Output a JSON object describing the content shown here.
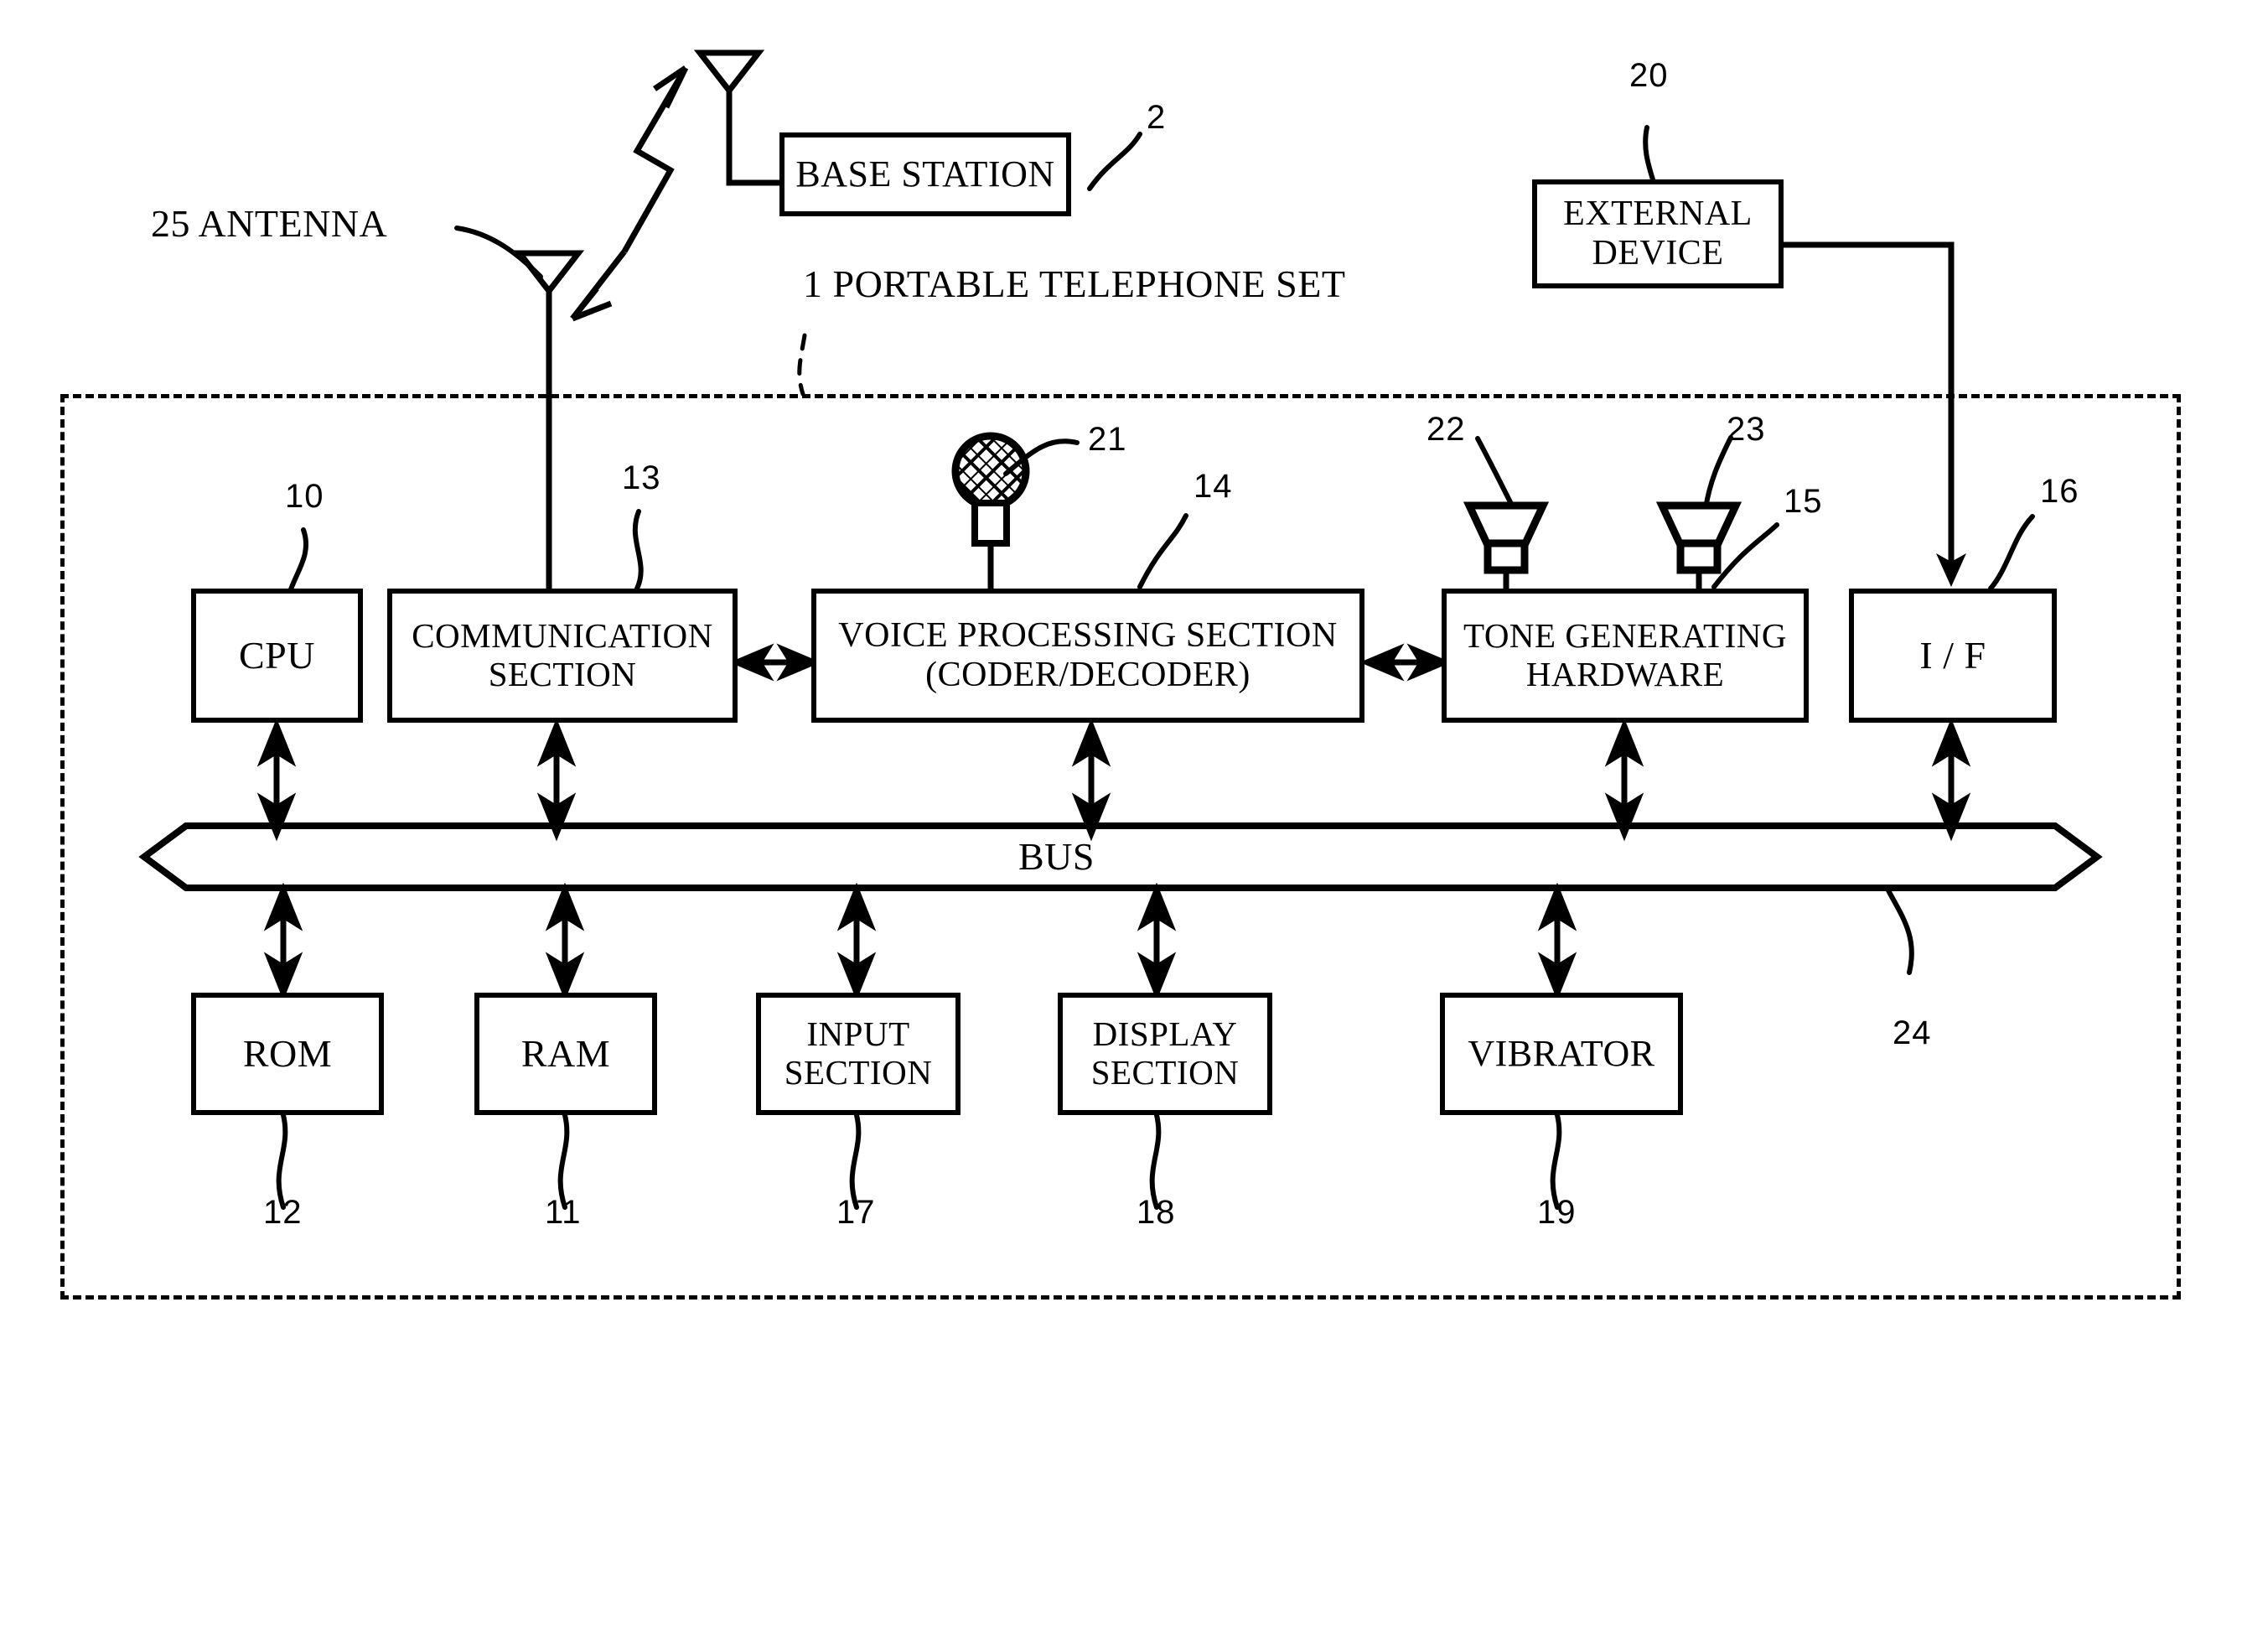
{
  "figure": {
    "title_label": "1  PORTABLE TELEPHONE SET",
    "antenna_label": "25  ANTENNA"
  },
  "boxes": {
    "base_station": "BASE STATION",
    "external_device_line1": "EXTERNAL",
    "external_device_line2": "DEVICE",
    "cpu": "CPU",
    "communication_line1": "COMMUNICATION",
    "communication_line2": "SECTION",
    "voice_line1": "VOICE PROCESSING SECTION",
    "voice_line2": "(CODER/DECODER)",
    "tone_line1": "TONE GENERATING",
    "tone_line2": "HARDWARE",
    "interface": "I / F",
    "bus": "BUS",
    "rom": "ROM",
    "ram": "RAM",
    "input_line1": "INPUT",
    "input_line2": "SECTION",
    "display_line1": "DISPLAY",
    "display_line2": "SECTION",
    "vibrator": "VIBRATOR"
  },
  "refs": {
    "base_station": "2",
    "external_device": "20",
    "cpu": "10",
    "communication": "13",
    "voice_processing": "14",
    "tone_generating": "15",
    "interface": "16",
    "microphone": "21",
    "speaker_left": "22",
    "speaker_right": "23",
    "bus": "24",
    "rom": "12",
    "ram": "11",
    "input_section": "17",
    "display_section": "18",
    "vibrator": "19"
  },
  "icons": {
    "antenna_top": "antenna-icon",
    "antenna_phone": "antenna-icon",
    "radio_wave": "radio-wave-icon",
    "microphone": "microphone-icon",
    "speaker_left": "speaker-icon",
    "speaker_right": "speaker-icon"
  },
  "colors": {
    "line": "#000000",
    "background": "#ffffff"
  }
}
